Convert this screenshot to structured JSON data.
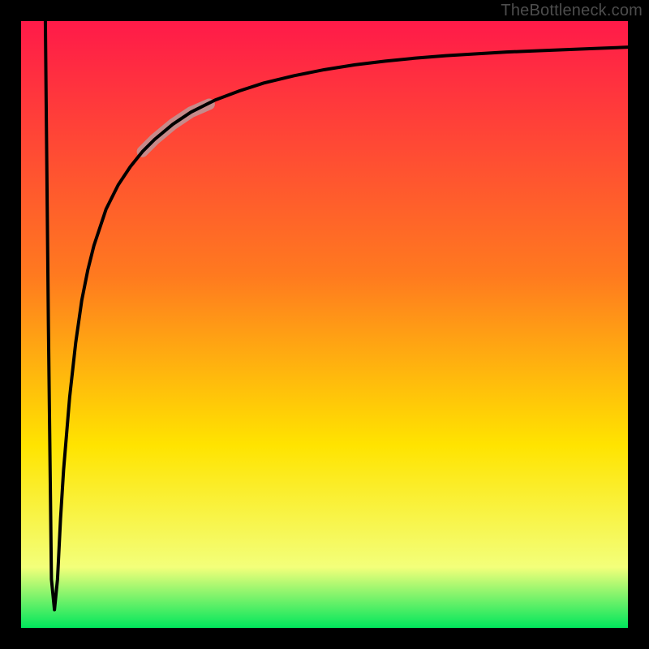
{
  "watermark": "TheBottleneck.com",
  "colors": {
    "frame": "#000000",
    "gradient_top": "#ff1a49",
    "gradient_mid1": "#ff7a1f",
    "gradient_mid2": "#ffe400",
    "gradient_mid3": "#f3ff7a",
    "gradient_bottom": "#00e65c",
    "curve": "#000000",
    "highlight": "#c68a8a"
  },
  "chart_data": {
    "type": "line",
    "title": "",
    "xlabel": "",
    "ylabel": "",
    "xlim": [
      0,
      100
    ],
    "ylim": [
      0,
      100
    ],
    "grid": false,
    "legend": false,
    "annotations": [],
    "series": [
      {
        "name": "bottleneck-curve",
        "x": [
          4,
          4.5,
          5,
          5.5,
          6,
          6.5,
          7,
          7.5,
          8,
          9,
          10,
          11,
          12,
          14,
          16,
          18,
          20,
          22,
          25,
          28,
          32,
          36,
          40,
          45,
          50,
          55,
          60,
          65,
          70,
          75,
          80,
          85,
          90,
          95,
          100
        ],
        "y": [
          100,
          50,
          8,
          3,
          8,
          18,
          26,
          32,
          38,
          47,
          54,
          59,
          63,
          69,
          73,
          76,
          78.5,
          80.5,
          83,
          85,
          87,
          88.5,
          89.8,
          91,
          92,
          92.8,
          93.4,
          93.9,
          94.3,
          94.6,
          94.9,
          95.1,
          95.3,
          95.5,
          95.7
        ]
      },
      {
        "name": "highlight-segment",
        "x": [
          20,
          22,
          25,
          28,
          31
        ],
        "y": [
          78.5,
          80.5,
          83,
          85,
          86.3
        ]
      }
    ]
  }
}
